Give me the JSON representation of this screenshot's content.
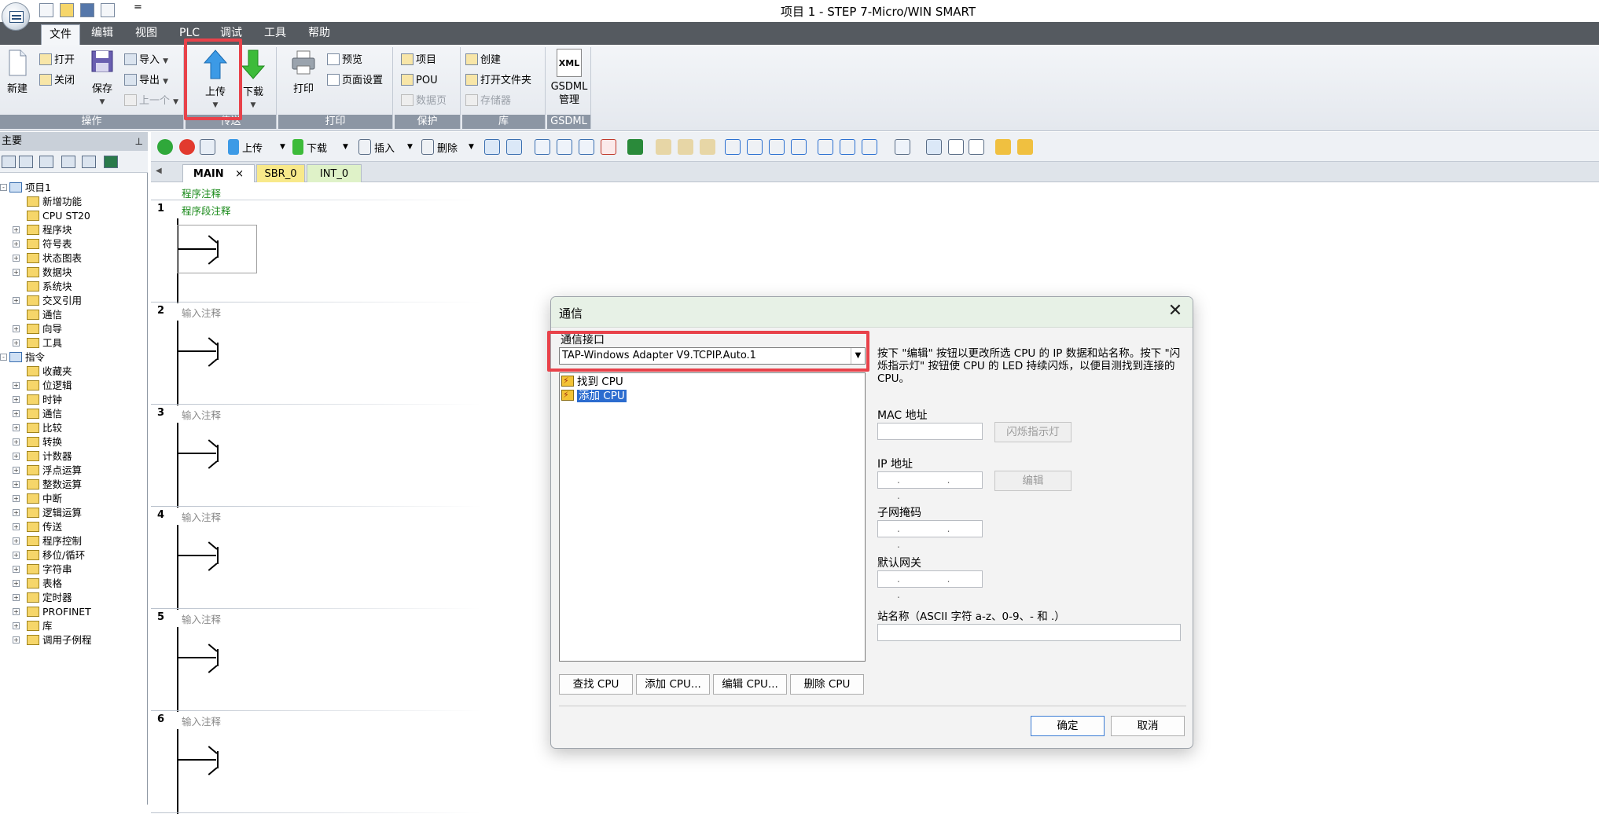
{
  "window": {
    "title": "项目 1 - STEP 7-Micro/WIN SMART",
    "qa_more": "="
  },
  "ribbon_tabs": [
    "文件",
    "编辑",
    "视图",
    "PLC",
    "调试",
    "工具",
    "帮助"
  ],
  "ribbon": {
    "operation": {
      "label": "操作",
      "new": "新建",
      "open": "打开",
      "close": "关闭",
      "save": "保存",
      "import": "导入",
      "export": "导出",
      "previous": "上一个"
    },
    "transfer": {
      "label": "传送",
      "upload": "上传",
      "download": "下载"
    },
    "print": {
      "label": "打印",
      "print": "打印",
      "preview": "预览",
      "page_setup": "页面设置"
    },
    "protect": {
      "label": "保护",
      "project": "项目",
      "pou": "POU",
      "data_page": "数据页"
    },
    "library": {
      "label": "库",
      "create": "创建",
      "open_folder": "打开文件夹",
      "memory": "存储器"
    },
    "gsdml": {
      "label": "GSDML",
      "button": "GSDML\n管理",
      "icon_text": "XML"
    }
  },
  "left_panel": {
    "title": "主要",
    "tree": [
      {
        "label": "项目1",
        "level": 0,
        "expander": "-"
      },
      {
        "label": "新增功能",
        "level": 1,
        "expander": ""
      },
      {
        "label": "CPU ST20",
        "level": 1,
        "expander": ""
      },
      {
        "label": "程序块",
        "level": 1,
        "expander": "+"
      },
      {
        "label": "符号表",
        "level": 1,
        "expander": "+"
      },
      {
        "label": "状态图表",
        "level": 1,
        "expander": "+"
      },
      {
        "label": "数据块",
        "level": 1,
        "expander": "+"
      },
      {
        "label": "系统块",
        "level": 1,
        "expander": ""
      },
      {
        "label": "交叉引用",
        "level": 1,
        "expander": "+"
      },
      {
        "label": "通信",
        "level": 1,
        "expander": ""
      },
      {
        "label": "向导",
        "level": 1,
        "expander": "+"
      },
      {
        "label": "工具",
        "level": 1,
        "expander": "+"
      },
      {
        "label": "指令",
        "level": 0,
        "expander": "-"
      },
      {
        "label": "收藏夹",
        "level": 1,
        "expander": ""
      },
      {
        "label": "位逻辑",
        "level": 1,
        "expander": "+"
      },
      {
        "label": "时钟",
        "level": 1,
        "expander": "+"
      },
      {
        "label": "通信",
        "level": 1,
        "expander": "+"
      },
      {
        "label": "比较",
        "level": 1,
        "expander": "+"
      },
      {
        "label": "转换",
        "level": 1,
        "expander": "+"
      },
      {
        "label": "计数器",
        "level": 1,
        "expander": "+"
      },
      {
        "label": "浮点运算",
        "level": 1,
        "expander": "+"
      },
      {
        "label": "整数运算",
        "level": 1,
        "expander": "+"
      },
      {
        "label": "中断",
        "level": 1,
        "expander": "+"
      },
      {
        "label": "逻辑运算",
        "level": 1,
        "expander": "+"
      },
      {
        "label": "传送",
        "level": 1,
        "expander": "+"
      },
      {
        "label": "程序控制",
        "level": 1,
        "expander": "+"
      },
      {
        "label": "移位/循环",
        "level": 1,
        "expander": "+"
      },
      {
        "label": "字符串",
        "level": 1,
        "expander": "+"
      },
      {
        "label": "表格",
        "level": 1,
        "expander": "+"
      },
      {
        "label": "定时器",
        "level": 1,
        "expander": "+"
      },
      {
        "label": "PROFINET",
        "level": 1,
        "expander": "+"
      },
      {
        "label": "库",
        "level": 1,
        "expander": "+"
      },
      {
        "label": "调用子例程",
        "level": 1,
        "expander": "+"
      }
    ]
  },
  "editor_toolbar": {
    "upload": "上传",
    "download": "下载",
    "insert": "插入",
    "delete": "删除"
  },
  "editor_tabs": [
    {
      "label": "MAIN",
      "close": "×"
    },
    {
      "label": "SBR_0"
    },
    {
      "label": "INT_0"
    }
  ],
  "ladder": {
    "program_comment": "程序注释",
    "networks": [
      {
        "number": "1",
        "comment": "程序段注释"
      },
      {
        "number": "2",
        "comment": "输入注释"
      },
      {
        "number": "3",
        "comment": "输入注释"
      },
      {
        "number": "4",
        "comment": "输入注释"
      },
      {
        "number": "5",
        "comment": "输入注释"
      },
      {
        "number": "6",
        "comment": "输入注释"
      }
    ]
  },
  "dialog": {
    "title": "通信",
    "close": "✕",
    "interface_label": "通信接口",
    "interface_value": "TAP-Windows Adapter V9.TCPIP.Auto.1",
    "list_items": [
      "找到 CPU",
      "添加 CPU"
    ],
    "selected_item": "添加 CPU",
    "description": "按下 \"编辑\" 按钮以更改所选 CPU 的 IP 数据和站名称。按下 \"闪烁指示灯\" 按钮使 CPU 的 LED 持续闪烁，以便目测找到连接的 CPU。",
    "mac_label": "MAC 地址",
    "flash_button": "闪烁指示灯",
    "ip_label": "IP 地址",
    "edit_button": "编辑",
    "subnet_label": "子网掩码",
    "gateway_label": "默认网关",
    "station_label": "站名称（ASCII 字符 a-z、0-9、- 和 .）",
    "ip_placeholder": ". . .",
    "buttons": {
      "find": "查找 CPU",
      "add": "添加 CPU...",
      "edit": "编辑 CPU...",
      "delete": "删除 CPU"
    },
    "ok": "确定",
    "cancel": "取消"
  },
  "colors": {
    "highlight": "#e8424a",
    "selection": "#2c6ccf",
    "comment_green": "#1a8a1a",
    "sbr_tab": "#f8e98a",
    "int_tab": "#dff2c8"
  }
}
